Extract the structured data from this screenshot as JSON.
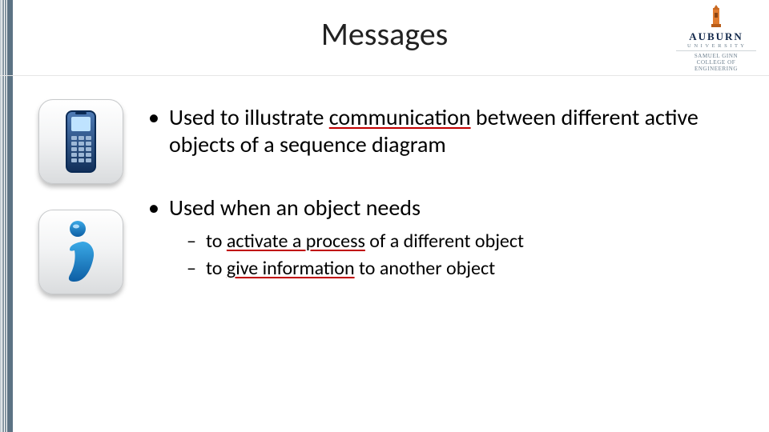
{
  "title": "Messages",
  "logo": {
    "university": "AUBURN",
    "line1": "U N I V E R S I T Y",
    "line2": "SAMUEL GINN",
    "line3": "COLLEGE OF ENGINEERING"
  },
  "icons": {
    "phone_name": "mobile-phone-icon",
    "info_name": "info-icon"
  },
  "bullets": [
    {
      "pre": "Used to illustrate ",
      "underlined": "communication",
      "post": " between different active objects of a sequence diagram"
    },
    {
      "pre": "Used when an object needs",
      "underlined": "",
      "post": "",
      "sub": [
        {
          "pre": "to ",
          "underlined": "activate a process",
          "post": " of a different object"
        },
        {
          "pre": "to ",
          "underlined": "give information",
          "post": " to another object"
        }
      ]
    }
  ]
}
